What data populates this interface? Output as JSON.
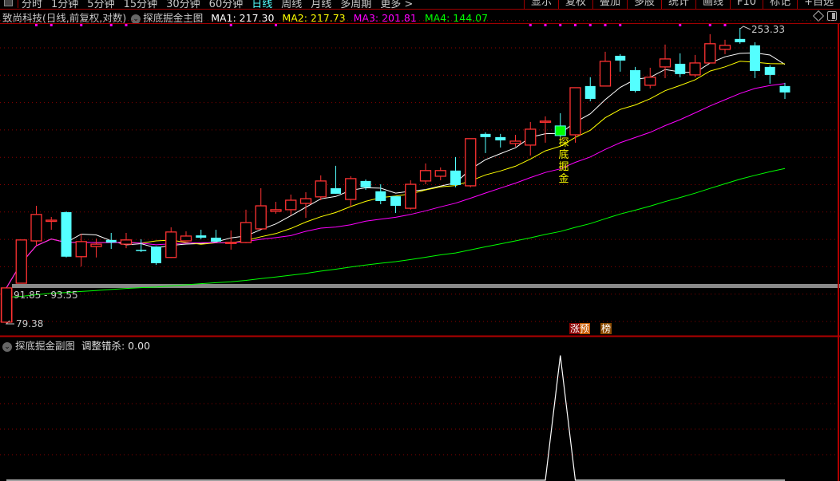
{
  "topbar": {
    "periods": [
      "分时",
      "1分钟",
      "5分钟",
      "15分钟",
      "30分钟",
      "60分钟",
      "日线",
      "周线",
      "月线",
      "多周期",
      "更多 >"
    ],
    "active_period": "日线",
    "tools": [
      "显示",
      "复权",
      "叠加",
      "多股",
      "统计",
      "画线",
      "F10",
      "标记",
      "+自选"
    ]
  },
  "main": {
    "stock_title": "致尚科技(日线,前复权,对数)",
    "indicator_name": "探底掘金主图",
    "ma1": "MA1: 217.30",
    "ma2": "MA2: 217.73",
    "ma3": "MA3: 201.81",
    "ma4": "MA4: 144.07",
    "high_label": "253.33",
    "low_label": "79.38",
    "range_label": "91.85 - 93.55",
    "signal_text": [
      "探",
      "底",
      "掘",
      "金"
    ],
    "badge_1": "涨预",
    "badge_2": "榜"
  },
  "sub": {
    "indicator_name": "探底掘金副图",
    "value_label": "调整错杀: 0.00"
  },
  "colors": {
    "up": "#ff3232",
    "down": "#54ffff",
    "ma1": "#ffffff",
    "ma2": "#ffff00",
    "ma3": "#ff00ff",
    "ma4": "#00ff00",
    "signal": "#00ff00",
    "grid": "#8b0000",
    "dot": "#ff00ff"
  },
  "chart_data": {
    "type": "candlestick",
    "scale": "log",
    "ylim": [
      79.38,
      253.33
    ],
    "candles_ohlc": [
      [
        79.9,
        91.4,
        79.38,
        91.4
      ],
      [
        93.1,
        110.3,
        93.1,
        110.3
      ],
      [
        109.9,
        126.1,
        107.9,
        121.9
      ],
      [
        119.2,
        120.7,
        114.8,
        119.2
      ],
      [
        123.0,
        123.4,
        103.0,
        103.3
      ],
      [
        103.3,
        113.0,
        99.4,
        109.6
      ],
      [
        107.5,
        110.9,
        103.0,
        108.5
      ],
      [
        110.3,
        113.4,
        106.5,
        109.2
      ],
      [
        108.5,
        113.4,
        106.8,
        110.3
      ],
      [
        106.1,
        110.6,
        105.2,
        105.9
      ],
      [
        107.5,
        107.6,
        100.0,
        100.7
      ],
      [
        103.0,
        115.9,
        102.8,
        113.8
      ],
      [
        109.9,
        114.1,
        109.8,
        112.0
      ],
      [
        112.3,
        114.8,
        110.6,
        111.3
      ],
      [
        111.3,
        114.8,
        109.5,
        109.6
      ],
      [
        109.1,
        114.5,
        106.2,
        109.3
      ],
      [
        109.2,
        124.2,
        108.9,
        118.1
      ],
      [
        115.2,
        135.1,
        115.2,
        126.1
      ],
      [
        123.4,
        128.1,
        122.3,
        124.2
      ],
      [
        124.2,
        131.8,
        121.5,
        128.9
      ],
      [
        127.3,
        133.0,
        120.3,
        129.7
      ],
      [
        130.6,
        142.1,
        128.9,
        139.0
      ],
      [
        135.1,
        147.5,
        132.2,
        132.2
      ],
      [
        129.3,
        141.6,
        125.7,
        140.3
      ],
      [
        139.0,
        139.8,
        134.3,
        135.6
      ],
      [
        133.5,
        137.2,
        126.9,
        128.5
      ],
      [
        130.9,
        130.9,
        122.6,
        126.1
      ],
      [
        124.9,
        139.4,
        124.2,
        137.2
      ],
      [
        139.0,
        148.9,
        137.2,
        144.8
      ],
      [
        141.6,
        146.6,
        139.4,
        144.8
      ],
      [
        144.8,
        152.7,
        135.6,
        136.8
      ],
      [
        136.4,
        164.1,
        135.6,
        164.1
      ],
      [
        167.2,
        168.2,
        155.1,
        165.1
      ],
      [
        165.1,
        167.2,
        158.5,
        163.0
      ],
      [
        161.0,
        166.6,
        159.0,
        162.5
      ],
      [
        160.0,
        175.2,
        153.6,
        170.3
      ],
      [
        175.6,
        179.1,
        161.5,
        175.8
      ],
      [
        172.5,
        181.3,
        165.1,
        166.1
      ],
      [
        166.6,
        200.4,
        161.5,
        200.4
      ],
      [
        201.7,
        208.8,
        190.0,
        191.8
      ],
      [
        201.7,
        230.7,
        201.7,
        222.2
      ],
      [
        227.1,
        228.6,
        213.4,
        222.9
      ],
      [
        214.7,
        217.4,
        196.7,
        197.9
      ],
      [
        202.3,
        216.7,
        199.8,
        208.8
      ],
      [
        217.4,
        237.3,
        208.1,
        224.3
      ],
      [
        220.1,
        229.3,
        208.8,
        211.4
      ],
      [
        210.7,
        227.9,
        208.8,
        220.8
      ],
      [
        220.8,
        247.2,
        220.8,
        238.1
      ],
      [
        232.9,
        241.8,
        228.6,
        236.6
      ],
      [
        242.6,
        253.33,
        238.1,
        239.5
      ],
      [
        236.6,
        239.5,
        208.1,
        214.0
      ],
      [
        217.4,
        218.8,
        203.6,
        210.7
      ],
      [
        201.7,
        204.2,
        191.8,
        196.7
      ]
    ],
    "signal_candle_index": 37,
    "marker_dot_indices": [
      2,
      3,
      5,
      7,
      8,
      15,
      18,
      35,
      36,
      37,
      38,
      39,
      40,
      41,
      45,
      47,
      48
    ],
    "sub_values_index_value": [
      [
        37,
        100
      ]
    ],
    "sub_ylim": [
      0,
      110
    ]
  }
}
